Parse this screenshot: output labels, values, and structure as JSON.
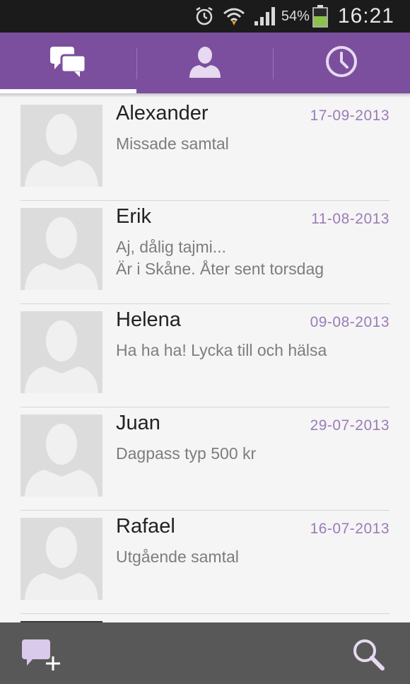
{
  "status_bar": {
    "icons": [
      "alarm-icon",
      "wifi-icon",
      "signal-icon",
      "battery-icon"
    ],
    "battery_percent": "54%",
    "time": "16:21"
  },
  "tabs": [
    {
      "name": "chats",
      "icon": "chat-bubbles-icon",
      "active": true
    },
    {
      "name": "contacts",
      "icon": "person-icon",
      "active": false
    },
    {
      "name": "recent",
      "icon": "clock-icon",
      "active": false
    }
  ],
  "conversations": [
    {
      "name": "Alexander",
      "date": "17-09-2013",
      "preview_line1": "Missade samtal",
      "preview_line2": ""
    },
    {
      "name": "Erik",
      "date": "11-08-2013",
      "preview_line1": "Aj, dålig tajmi...",
      "preview_line2": "Är i Skåne. Åter sent torsdag"
    },
    {
      "name": "Helena",
      "date": "09-08-2013",
      "preview_line1": "Ha ha ha! Lycka till och hälsa",
      "preview_line2": ""
    },
    {
      "name": "Juan",
      "date": "29-07-2013",
      "preview_line1": "Dagpass typ 500 kr",
      "preview_line2": ""
    },
    {
      "name": "Rafael",
      "date": "16-07-2013",
      "preview_line1": "Utgående samtal",
      "preview_line2": ""
    }
  ],
  "bottom_bar": {
    "left_icon": "new-message-icon",
    "right_icon": "search-icon"
  },
  "colors": {
    "accent": "#7b4f9d",
    "date_text": "#9b7bb9",
    "status_bar_bg": "#1b1b1b",
    "bottom_bar_bg": "#585858",
    "battery_fill": "#8bc34a"
  }
}
